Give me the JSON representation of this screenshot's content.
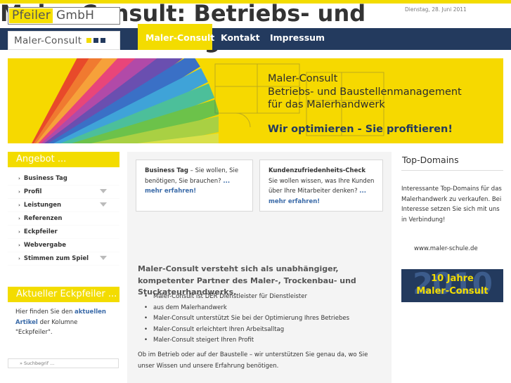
{
  "header": {
    "logo_part1": "Pfeiler",
    "logo_part2": "GmbH",
    "date": "Dienstag, 28. Juni 2011",
    "brand": "Maler-Consult"
  },
  "nav": {
    "items": [
      {
        "label": "Maler-Consult",
        "active": true
      },
      {
        "label": "Kontakt",
        "active": false
      },
      {
        "label": "Impressum",
        "active": false
      }
    ]
  },
  "banner": {
    "line1": "Maler-Consult",
    "line2": "Betriebs- und Baustellenmanagement",
    "line3": "für das Malerhandwerk",
    "slogan": "Wir optimieren - Sie profitieren!"
  },
  "sidebar": {
    "heading": "Angebot ...",
    "items": [
      {
        "label": "Business Tag",
        "submenu": false
      },
      {
        "label": "Profil",
        "submenu": true
      },
      {
        "label": "Leistungen",
        "submenu": true
      },
      {
        "label": "Referenzen",
        "submenu": false
      },
      {
        "label": "Eckpfeiler",
        "submenu": false
      },
      {
        "label": "Webvergabe",
        "submenu": false
      },
      {
        "label": "Stimmen zum Spiel",
        "submenu": true
      }
    ],
    "heading2": "Aktueller Eckpfeiler ...",
    "text_before": "Hier finden Sie den",
    "text_link": "aktuellen Artikel",
    "text_after": "der Kolumne \"Eckpfeiler\".",
    "search_placeholder": "» Suchbegrif ..."
  },
  "boxes": [
    {
      "title": "Business Tag",
      "text": " – Sie wollen, Sie benötigen, Sie brauchen?",
      "more": "... mehr erfahren!"
    },
    {
      "title": "Kundenzufriedenheits-Check",
      "text": "Sie wollen wissen, was Ihre Kunden über Ihre Mitarbeiter denken?",
      "more": "... mehr erfahren!"
    }
  ],
  "main": {
    "heading": "Maler-Consult: Betriebs- und Baustellenmanagement",
    "lead": "Maler-Consult versteht sich als unabhängiger, kompetenter Partner des Maler-, Trockenbau- und Stuckateurhandwerks.",
    "bullets": [
      "Maler-Consult ist DER Dienstleister für Dienstleister",
      "aus dem Malerhandwerk",
      "Maler-Consult unterstützt Sie bei der Optimierung Ihres Betriebes",
      "Maler-Consult erleichtert Ihren Arbeitsalltag",
      "Maler-Consult steigert Ihren Profit"
    ],
    "para": "Ob im Betrieb oder auf der Baustelle – wir unterstützen Sie genau da, wo Sie unser Wissen und unsere Erfahrung benötigen."
  },
  "right": {
    "heading": "Top-Domains",
    "text": "Interessante Top-Domains für das Malerhandwerk zu verkaufen. Bei Interesse setzen Sie sich mit uns in Verbindung!",
    "url": "www.maler-schule.de",
    "promo_year": "2010",
    "promo_line1": "10 Jahre",
    "promo_line2": "Maler-Consult"
  },
  "colors": {
    "accent_yellow": "#f3dc00",
    "navy": "#233a5e",
    "link_blue": "#3a6aa8"
  }
}
